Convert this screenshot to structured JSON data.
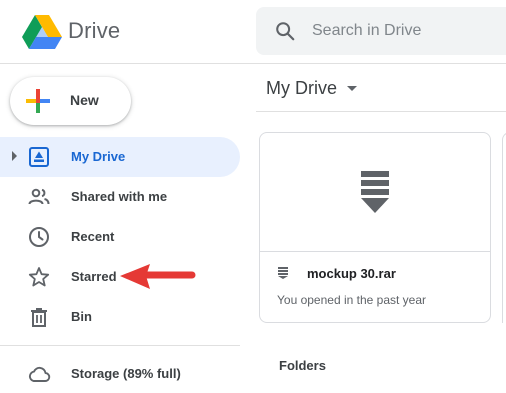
{
  "header": {
    "app_title": "Drive",
    "logo_icon": "google-drive-logo",
    "search": {
      "placeholder": "Search in Drive",
      "value": "",
      "icon": "search-icon"
    }
  },
  "sidebar": {
    "new_button": {
      "label": "New",
      "icon": "plus-icon"
    },
    "items": [
      {
        "label": "My Drive",
        "icon": "my-drive-icon",
        "active": true,
        "expandable": true
      },
      {
        "label": "Shared with me",
        "icon": "people-icon",
        "active": false
      },
      {
        "label": "Recent",
        "icon": "clock-icon",
        "active": false
      },
      {
        "label": "Starred",
        "icon": "star-icon",
        "active": false
      },
      {
        "label": "Bin",
        "icon": "trash-icon",
        "active": false
      },
      {
        "label": "Storage (89% full)",
        "icon": "cloud-icon",
        "active": false
      }
    ]
  },
  "main": {
    "title": "My Drive",
    "files": [
      {
        "name": "mockup 30.rar",
        "subtitle": "You opened in the past year",
        "icon": "archive-icon"
      }
    ],
    "folders_heading": "Folders"
  },
  "annotation": {
    "arrow_color": "#e53935",
    "points_to": "Starred"
  },
  "colors": {
    "active_bg": "#e8f0fe",
    "active_text": "#1967d2",
    "search_bg": "#f1f3f4",
    "border": "#dadce0"
  }
}
